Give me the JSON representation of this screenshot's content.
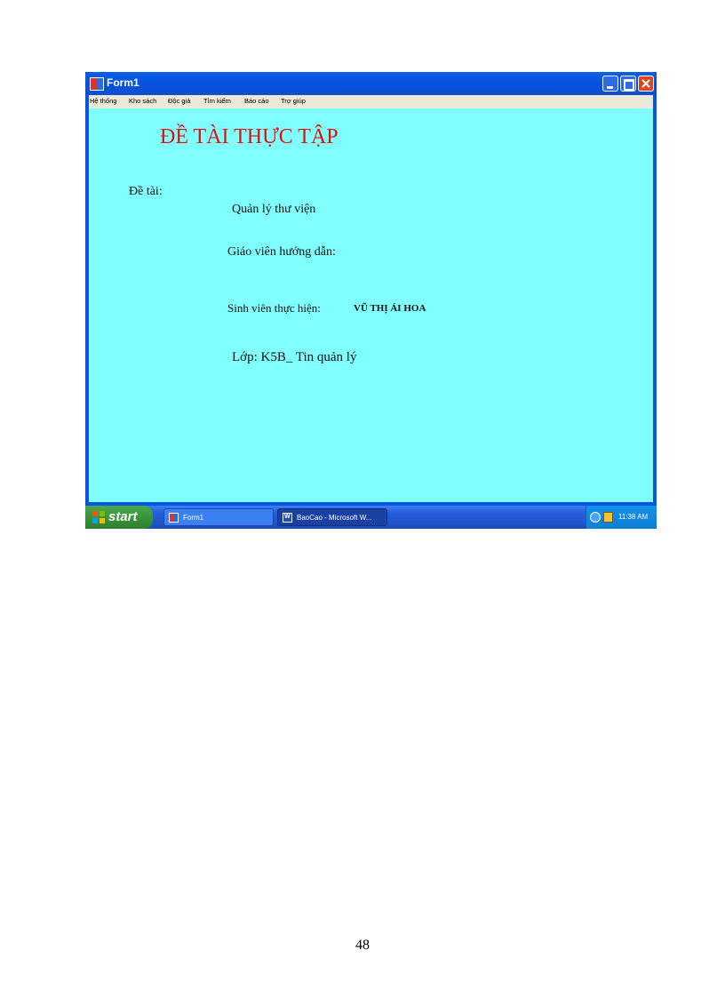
{
  "window": {
    "title": "Form1",
    "menu": [
      "Hệ thống",
      "Kho sách",
      "Độc giả",
      "Tìm kiếm",
      "Báo cáo",
      "Trợ giúp"
    ]
  },
  "form": {
    "heading": "ĐỀ TÀI THỰC TẬP",
    "topic_label": "Đề tài:",
    "topic_value": "Quản lý thư viện",
    "teacher_label": "Giáo viên hướng dẫn:",
    "student_label": "Sinh viên thực hiện:",
    "student_value": "VŨ THỊ ÁI HOA",
    "class_label": "Lớp: K5B_ Tin quản lý"
  },
  "taskbar": {
    "start_label": "start",
    "tasks": [
      "Form1",
      "BaoCao - Microsoft W..."
    ],
    "clock": "11:38 AM"
  },
  "page_number": "48",
  "colors": {
    "form_background": "#80ffff",
    "heading": "#e01010",
    "titlebar": "#0553df",
    "start_button": "#37953a"
  }
}
